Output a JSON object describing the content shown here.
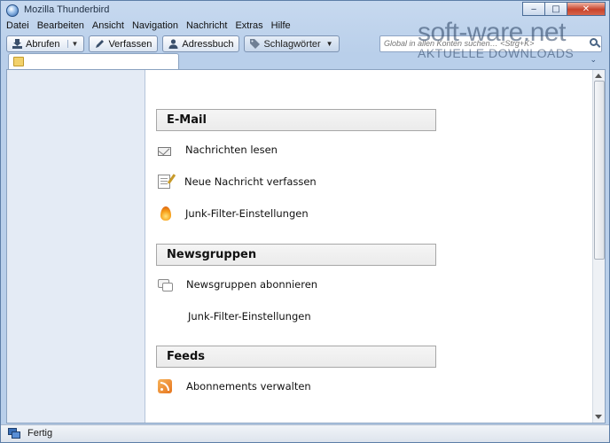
{
  "window": {
    "title": "Mozilla Thunderbird"
  },
  "menu": [
    "Datei",
    "Bearbeiten",
    "Ansicht",
    "Navigation",
    "Nachricht",
    "Extras",
    "Hilfe"
  ],
  "toolbar": {
    "get_label": "Abrufen",
    "write_label": "Verfassen",
    "address_label": "Adressbuch",
    "tags_label": "Schlagwörter"
  },
  "search": {
    "placeholder": "Global in allen Konten suchen… <Strg+K>"
  },
  "sections": [
    {
      "title": "E-Mail",
      "items": [
        "Nachrichten lesen",
        "Neue Nachricht verfassen",
        "Junk-Filter-Einstellungen"
      ]
    },
    {
      "title": "Newsgruppen",
      "items": [
        "Newsgruppen abonnieren",
        "Junk-Filter-Einstellungen"
      ]
    },
    {
      "title": "Feeds",
      "items": [
        "Abonnements verwalten"
      ]
    }
  ],
  "status": {
    "text": "Fertig"
  },
  "watermark": {
    "line1": "soft-ware.net",
    "line2": "AKTUELLE DOWNLOADS"
  },
  "icons": {
    "app": "thunderbird-icon",
    "get": "download-icon",
    "write": "pen-icon",
    "address": "person-icon",
    "tags": "tag-icon",
    "search": "search-icon",
    "tab": "folder-icon",
    "status": "network-icon"
  }
}
